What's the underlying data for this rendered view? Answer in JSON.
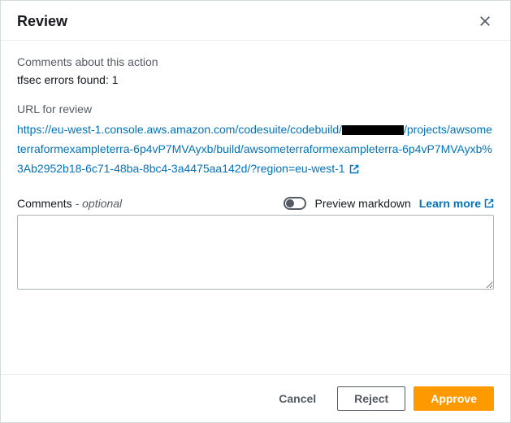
{
  "header": {
    "title": "Review"
  },
  "body": {
    "commentsAboutLabel": "Comments about this action",
    "commentsAboutValue": "tfsec errors found: 1",
    "urlLabel": "URL for review",
    "url": {
      "part1": "https://eu-west-1.console.aws.amazon.com/codesuite/codebuild/",
      "part2": "/projects/awsometerraformexampleterra-6p4vP7MVAyxb/build/awsometerraformexampleterra-6p4vP7MVAyxb%3Ab2952b18-6c71-48ba-8bc4-3a4475aa142d/?region=eu-west-1"
    },
    "commentsLabel": "Comments",
    "optionalText": " - optional",
    "previewLabel": "Preview markdown",
    "learnMoreLabel": "Learn more",
    "textareaValue": ""
  },
  "footer": {
    "cancel": "Cancel",
    "reject": "Reject",
    "approve": "Approve"
  }
}
